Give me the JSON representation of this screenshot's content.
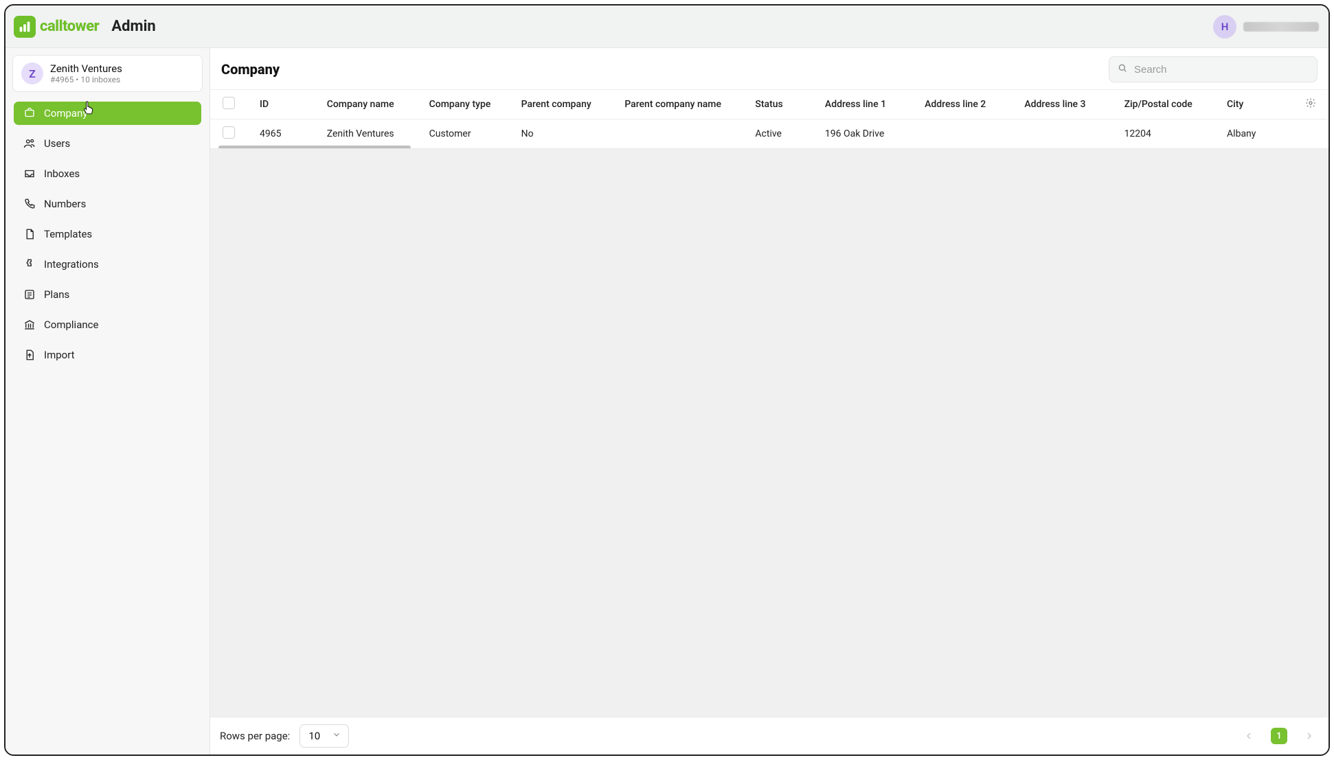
{
  "brand": {
    "word": "calltower"
  },
  "header": {
    "title": "Admin",
    "user_initial": "H"
  },
  "org": {
    "initial": "Z",
    "name": "Zenith Ventures",
    "meta": "#4965 • 10 inboxes"
  },
  "sidebar": {
    "items": [
      {
        "label": "Company",
        "icon": "company-icon",
        "active": true
      },
      {
        "label": "Users",
        "icon": "users-icon",
        "active": false
      },
      {
        "label": "Inboxes",
        "icon": "inbox-icon",
        "active": false
      },
      {
        "label": "Numbers",
        "icon": "phone-icon",
        "active": false
      },
      {
        "label": "Templates",
        "icon": "file-icon",
        "active": false
      },
      {
        "label": "Integrations",
        "icon": "puzzle-icon",
        "active": false
      },
      {
        "label": "Plans",
        "icon": "list-icon",
        "active": false
      },
      {
        "label": "Compliance",
        "icon": "bank-icon",
        "active": false
      },
      {
        "label": "Import",
        "icon": "upload-file-icon",
        "active": false
      }
    ]
  },
  "page": {
    "title": "Company"
  },
  "search": {
    "placeholder": "Search"
  },
  "table": {
    "columns": [
      "ID",
      "Company name",
      "Company type",
      "Parent company",
      "Parent company name",
      "Status",
      "Address line 1",
      "Address line 2",
      "Address line 3",
      "Zip/Postal code",
      "City"
    ],
    "rows": [
      {
        "id": "4965",
        "company_name": "Zenith Ventures",
        "company_type": "Customer",
        "parent_company": "No",
        "parent_company_name": "",
        "status": "Active",
        "address_line_1": "196 Oak Drive",
        "address_line_2": "",
        "address_line_3": "",
        "zip": "12204",
        "city": "Albany"
      }
    ]
  },
  "footer": {
    "rows_per_page_label": "Rows per page:",
    "rows_per_page_value": "10",
    "current_page": "1"
  },
  "colors": {
    "accent": "#78c12f",
    "brand": "#6fbf2a"
  }
}
